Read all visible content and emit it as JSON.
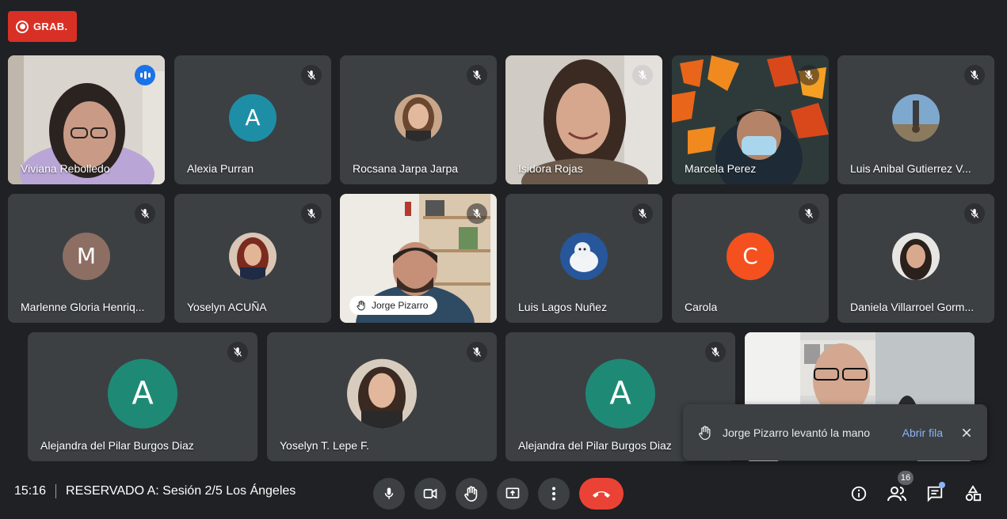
{
  "recording": {
    "label": "GRAB."
  },
  "tiles": [
    {
      "name": "Viviana Rebolledo",
      "kind": "video",
      "speaking": true
    },
    {
      "name": "Alexia Purran",
      "kind": "letter",
      "letter": "A",
      "color": "#1e8ea6",
      "muted": true
    },
    {
      "name": "Rocsana Jarpa Jarpa",
      "kind": "photo",
      "muted": true
    },
    {
      "name": "Isidora Rojas",
      "kind": "video",
      "muted": true
    },
    {
      "name": "Marcela Perez",
      "kind": "video",
      "muted": true
    },
    {
      "name": "Luis Anibal Gutierrez V...",
      "kind": "photo",
      "muted": true
    },
    {
      "name": "Marlenne Gloria Henriq...",
      "kind": "letter",
      "letter": "M",
      "color": "#8d6e63",
      "muted": true
    },
    {
      "name": "Yoselyn ACUÑA",
      "kind": "photo",
      "muted": true
    },
    {
      "name": "Jorge Pizarro",
      "kind": "video",
      "muted": true,
      "hand_raised": true
    },
    {
      "name": "Luis Lagos Nuñez",
      "kind": "photo",
      "muted": true
    },
    {
      "name": "Carola",
      "kind": "letter",
      "letter": "C",
      "color": "#f4511e",
      "muted": true
    },
    {
      "name": "Daniela Villarroel Gorm...",
      "kind": "photo",
      "muted": true
    },
    {
      "name": "Alejandra del Pilar Burgos Diaz",
      "kind": "letter",
      "letter": "A",
      "color": "#1e8a76",
      "muted": true
    },
    {
      "name": "Yoselyn T. Lepe F.",
      "kind": "photo",
      "muted": true
    },
    {
      "name": "Alejandra del Pilar Burgos Diaz",
      "kind": "letter",
      "letter": "A",
      "color": "#1e8a76",
      "muted": true
    },
    {
      "name": "",
      "kind": "video"
    }
  ],
  "toast": {
    "message": "Jorge Pizarro levantó la mano",
    "action": "Abrir fila"
  },
  "meeting": {
    "time": "15:16",
    "title": "RESERVADO A: Sesión 2/5 Los Ángeles"
  },
  "people_count": "16",
  "icons": {
    "mic": "mic-icon",
    "camera": "videocam-icon",
    "hand": "raise-hand-icon",
    "present": "present-screen-icon",
    "more": "more-vert-icon",
    "end": "call-end-icon",
    "info": "info-icon",
    "people": "people-icon",
    "chat": "chat-icon",
    "activities": "activities-icon"
  },
  "colors": {
    "background": "#202124",
    "tile": "#3c4043",
    "accent": "#8ab4f8",
    "danger": "#ea4335"
  }
}
